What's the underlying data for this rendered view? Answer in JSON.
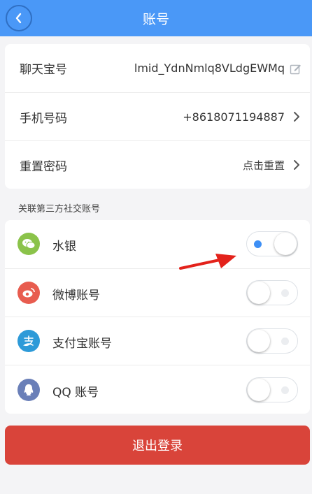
{
  "header": {
    "title": "账号",
    "back_icon": "chevron-left-icon"
  },
  "account": {
    "chat_id_label": "聊天宝号",
    "chat_id_value": "lmid_YdnNmlq8VLdgEWMq",
    "phone_label": "手机号码",
    "phone_value": "+8618071194887",
    "password_label": "重置密码",
    "password_value": "点击重置"
  },
  "social_section_label": "关联第三方社交账号",
  "social": [
    {
      "label": "水银",
      "icon": "wechat-icon",
      "color": "#8bc34a",
      "enabled": true
    },
    {
      "label": "微博账号",
      "icon": "weibo-icon",
      "color": "#e85c4f",
      "enabled": false
    },
    {
      "label": "支付宝账号",
      "icon": "alipay-icon",
      "color": "#2d9ad8",
      "enabled": false
    },
    {
      "label": "QQ 账号",
      "icon": "qq-icon",
      "color": "#6a7fb8",
      "enabled": false
    }
  ],
  "logout_label": "退出登录",
  "colors": {
    "header": "#4a98f7",
    "logout": "#d9443a",
    "toggle_on": "#3d8ff5",
    "annotation_arrow": "#e3221b"
  }
}
